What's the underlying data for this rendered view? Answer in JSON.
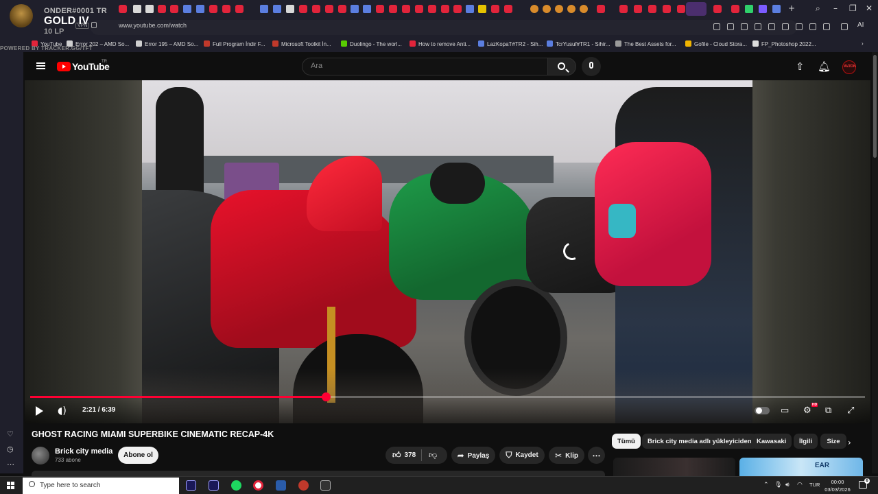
{
  "overlay": {
    "name": "ONDER#0001 TR",
    "rank": "GOLD IV",
    "lp": "10 LP",
    "powered": "POWERED BY TRACKER.GG/TFT"
  },
  "browser": {
    "url": "www.youtube.com/watch",
    "vpn": "VPN",
    "ai_label": "AI",
    "bookmarks": [
      {
        "label": "YouTube",
        "color": "#e2243b"
      },
      {
        "label": "Error 202 – AMD So...",
        "color": "#cfcfcf"
      },
      {
        "label": "Error 195 – AMD So...",
        "color": "#cfcfcf"
      },
      {
        "label": "Full Program İndir F...",
        "color": "#c0392b"
      },
      {
        "label": "Microsoft Toolkit İn...",
        "color": "#c0392b"
      },
      {
        "label": "Duolingo - The worl...",
        "color": "#58cc02"
      },
      {
        "label": "How to remove Anti...",
        "color": "#e2243b"
      },
      {
        "label": "LazKopaT#TR2 - Sih...",
        "color": "#5b7ee0"
      },
      {
        "label": "TcrYusuf#TR1 - Sihir...",
        "color": "#5b7ee0"
      },
      {
        "label": "The Best Assets for...",
        "color": "#9a9a9a"
      },
      {
        "label": "Gofile - Cloud Stora...",
        "color": "#f0b400"
      },
      {
        "label": "FP_Photoshop 2022...",
        "color": "#dddddd"
      }
    ]
  },
  "youtube": {
    "logo_text": "YouTube",
    "country": "TR",
    "search_placeholder": "Ara",
    "avatar_text": "AVZON"
  },
  "player": {
    "time": "2:21 / 6:39",
    "progress": 0.354,
    "hd_badge": "HD"
  },
  "video": {
    "title": "GHOST RACING MIAMI SUPERBIKE CINEMATIC RECAP-4K",
    "channel": "Brick city media",
    "subscribers": "733 abone",
    "subscribe_label": "Abone ol",
    "likes": "378",
    "share_label": "Paylaş",
    "save_label": "Kaydet",
    "clip_label": "Klip"
  },
  "chips": [
    {
      "label": "Tümü",
      "active": true
    },
    {
      "label": "Brick city media adlı yükleyiciden"
    },
    {
      "label": "Kawasaki"
    },
    {
      "label": "İlgili"
    },
    {
      "label": "Size"
    }
  ],
  "recommendation": {
    "thumb2_text": "EAR"
  },
  "taskbar": {
    "search_placeholder": "Type here to search",
    "language": "TUR",
    "time": "00:00",
    "date": "03/03/2026",
    "notifications": "6"
  }
}
